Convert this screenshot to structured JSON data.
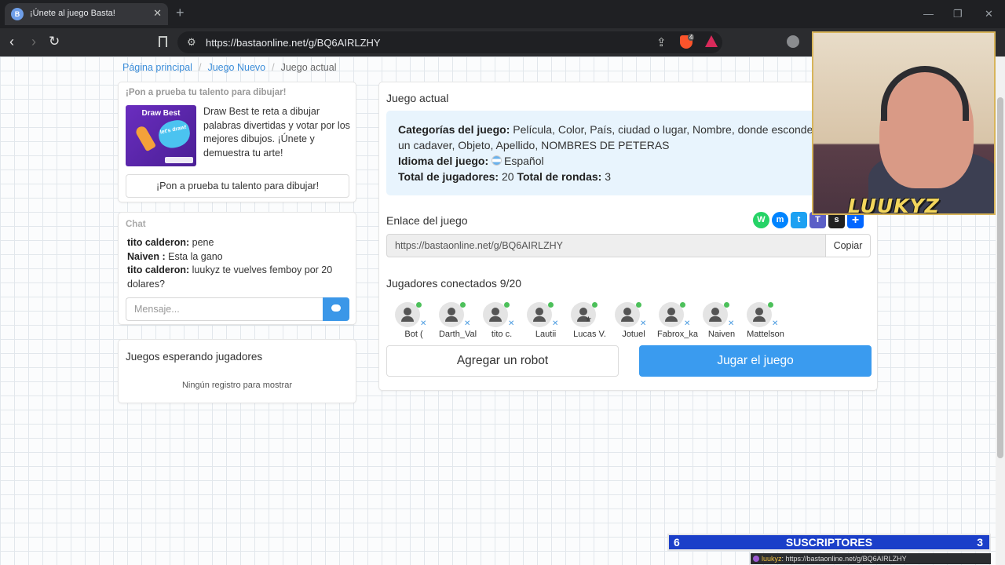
{
  "browser": {
    "tab_title": "¡Únete al juego Basta!",
    "tab_close": "✕",
    "new_tab": "+",
    "url": "https://bastaonline.net/g/BQ6AIRLZHY",
    "brave_badge": "4"
  },
  "breadcrumb": {
    "home": "Página principal",
    "new_game": "Juego Nuevo",
    "current": "Juego actual"
  },
  "promo": {
    "header": "¡Pon a prueba tu talento para dibujar!",
    "image_title": "Draw Best",
    "image_splash": "let's draw!",
    "text": "Draw Best te reta a dibujar palabras divertidas y votar por los mejores dibujos. ¡Únete y demuestra tu arte!",
    "button": "¡Pon a prueba tu talento para dibujar!"
  },
  "chat": {
    "header": "Chat",
    "messages": [
      {
        "user": "tito calderon:",
        "text": " pene"
      },
      {
        "user": "Naiven :",
        "text": " Esta la gano"
      },
      {
        "user": "tito calderon:",
        "text": " luukyz te vuelves femboy por 20 dolares?"
      }
    ],
    "placeholder": "Mensaje..."
  },
  "waiting": {
    "title": "Juegos esperando jugadores",
    "empty": "Ningún registro para mostrar"
  },
  "game": {
    "title": "Juego actual",
    "categories_label": "Categorías del juego:",
    "categories_value": " Película, Color, País, ciudad o lugar, Nombre, donde esconder un cadaver, Objeto, Apellido, NOMBRES DE PETERAS",
    "language_label": "Idioma del juego:",
    "language_value": "Español",
    "players_total_label": "Total de jugadores:",
    "players_total_value": " 20 ",
    "rounds_label": "Total de rondas:",
    "rounds_value": " 3",
    "link_label": "Enlace del juego",
    "link_value": "https://bastaonline.net/g/BQ6AIRLZHY",
    "copy_button": "Copiar",
    "players_label": "Jugadores conectados 9/20",
    "players": [
      "Bot (",
      "Darth_Val",
      "tito c.",
      "Lautii",
      "Lucas V.",
      "Jotuel",
      "Fabrox_ka",
      "Naiven",
      "Mattelson"
    ],
    "add_robot_button": "Agregar un robot",
    "play_button": "Jugar el juego",
    "share_icons": [
      {
        "name": "whatsapp-icon",
        "color": "#25d366",
        "glyph": "W"
      },
      {
        "name": "messenger-icon",
        "color": "#0084ff",
        "glyph": "m"
      },
      {
        "name": "twitter-icon",
        "color": "#1da1f2",
        "glyph": "t"
      },
      {
        "name": "teams-icon",
        "color": "#5b5fc7",
        "glyph": "T"
      },
      {
        "name": "snapchat-icon",
        "color": "#222222",
        "glyph": "s"
      },
      {
        "name": "more-share-icon",
        "color": "#0166ff",
        "glyph": "+"
      }
    ]
  },
  "overlay": {
    "streamer_name": "LUUKYZ",
    "sub_left": "6",
    "sub_title": "SUSCRIPTORES",
    "sub_right": "3",
    "ticker_name": "luukyz",
    "ticker_text": ": https://bastaonline.net/g/BQ6AIRLZHY"
  },
  "colors": {
    "accent": "#3a9bef",
    "link": "#3b8dd9",
    "info_bg": "#e8f4fd"
  }
}
